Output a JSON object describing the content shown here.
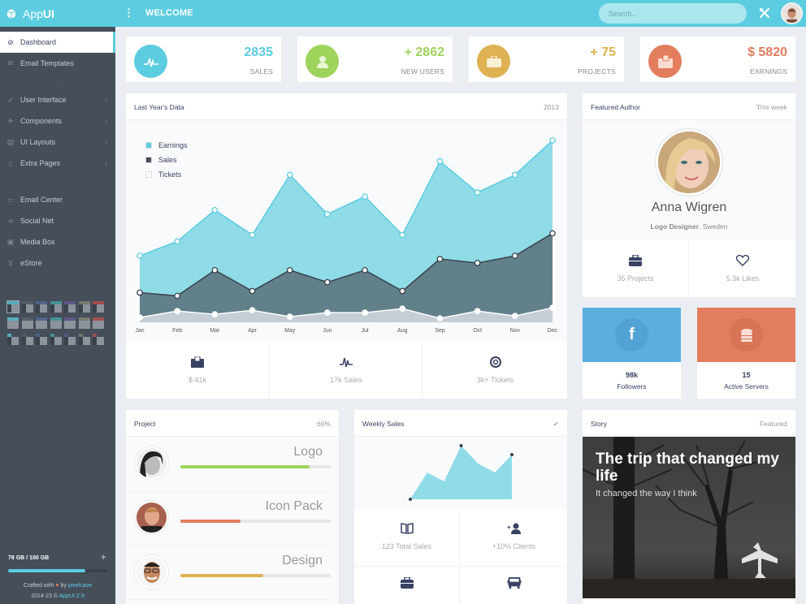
{
  "app": {
    "brand_prefix": "App",
    "brand_suffix": "UI",
    "welcome": "WELCOME",
    "search_placeholder": "Search.."
  },
  "sidebar": {
    "items": [
      {
        "label": "Dashboard",
        "icon": "compass-icon",
        "active": true
      },
      {
        "label": "Email Templates",
        "icon": "envelope-icon"
      },
      {
        "label": "User Interface",
        "icon": "rocket-icon",
        "chevron": true
      },
      {
        "label": "Components",
        "icon": "plane-icon",
        "chevron": true
      },
      {
        "label": "UI Layouts",
        "icon": "layers-icon",
        "chevron": true
      },
      {
        "label": "Extra Pages",
        "icon": "gift-icon",
        "chevron": true
      },
      {
        "label": "Email Center",
        "icon": "inbox-icon"
      },
      {
        "label": "Social Net",
        "icon": "share-icon"
      },
      {
        "label": "Media Box",
        "icon": "picture-icon"
      },
      {
        "label": "eStore",
        "icon": "cart-icon"
      }
    ],
    "separator": "...",
    "theme_colors": [
      "#5ccde0",
      "#5a6470",
      "#5b6a9a",
      "#4aa8ab",
      "#6a5b9a",
      "#8a8a7a",
      "#c0504d"
    ],
    "storage": {
      "text": "78 GB / 100 GB",
      "used_fraction": 0.78
    },
    "crafted_prefix": "Crafted with",
    "crafted_by": "by",
    "crafted_author": "pixelcave",
    "copyright": "2014-23 ©",
    "version": "AppUI 2.9"
  },
  "stats": [
    {
      "value": "2835",
      "label": "SALES",
      "color": "#5ccde0",
      "icon": "pulse-icon"
    },
    {
      "value": "+ 2862",
      "label": "NEW USERS",
      "color": "#9ed35c",
      "icon": "user-icon"
    },
    {
      "value": "+ 75",
      "label": "PROJECTS",
      "color": "#deb252",
      "icon": "briefcase-icon"
    },
    {
      "value": "$ 5820",
      "label": "EARNINGS",
      "color": "#e27d5e",
      "icon": "wallet-icon"
    }
  ],
  "last_year": {
    "title": "Last Year's Data",
    "year": "2013",
    "summary": [
      {
        "value": "$ 41k",
        "icon": "wallet-icon"
      },
      {
        "value": "17k Sales",
        "icon": "pulse-icon"
      },
      {
        "value": "3k+ Tickets",
        "icon": "lifebuoy-icon"
      }
    ]
  },
  "chart_data": {
    "type": "area",
    "title": "Last Year's Data",
    "categories": [
      "Jan",
      "Feb",
      "Mar",
      "Apr",
      "May",
      "Jun",
      "Jul",
      "Aug",
      "Sep",
      "Oct",
      "Nov",
      "Dec"
    ],
    "series": [
      {
        "name": "Earnings",
        "color": "#5ccde0",
        "values": [
          83,
          101,
          140,
          109,
          184,
          135,
          157,
          109,
          201,
          162,
          184,
          227
        ]
      },
      {
        "name": "Sales",
        "color": "#454e59",
        "values": [
          37,
          33,
          65,
          39,
          65,
          50,
          65,
          39,
          79,
          74,
          83,
          111
        ]
      },
      {
        "name": "Tickets",
        "color": "#ffffff",
        "values": [
          6,
          14,
          10,
          15,
          7,
          12,
          12,
          17,
          5,
          14,
          8,
          18
        ]
      }
    ],
    "ylim": [
      0,
      230
    ],
    "grid": false,
    "legend": "top-left",
    "xlabel": "",
    "ylabel": ""
  },
  "author": {
    "header": "Featured Author",
    "period": "This week",
    "name": "Anna Wigren",
    "role": "Logo Designer",
    "location": ", Sweden",
    "projects": "35 Projects",
    "likes": "5.3k Likes"
  },
  "social": [
    {
      "value": "98k",
      "label": "Followers",
      "color": "#5aafe0",
      "icon": "facebook-icon"
    },
    {
      "value": "15",
      "label": "Active Servers",
      "color": "#e27d5e",
      "icon": "database-icon"
    }
  ],
  "project": {
    "header": "Project",
    "percent": "60%",
    "items": [
      {
        "name": "Logo",
        "progress": 0.86,
        "color": "#9ed35c"
      },
      {
        "name": "Icon Pack",
        "progress": 0.4,
        "color": "#e27d5e"
      },
      {
        "name": "Design",
        "progress": 0.55,
        "color": "#deb252"
      }
    ]
  },
  "weekly": {
    "header": "Weekly Sales",
    "chart_values": [
      0,
      6,
      4,
      12,
      8,
      6,
      10
    ],
    "stats": [
      {
        "value": "123 Total Sales",
        "icon": "book-icon"
      },
      {
        "value": "+10% Clients",
        "icon": "add-user-icon"
      },
      {
        "value": "",
        "icon": "briefcase-icon"
      },
      {
        "value": "",
        "icon": "bus-icon"
      }
    ]
  },
  "story": {
    "header": "Story",
    "badge": "Featured",
    "title": "The trip that changed my life",
    "subtitle": "It changed the way I think"
  }
}
